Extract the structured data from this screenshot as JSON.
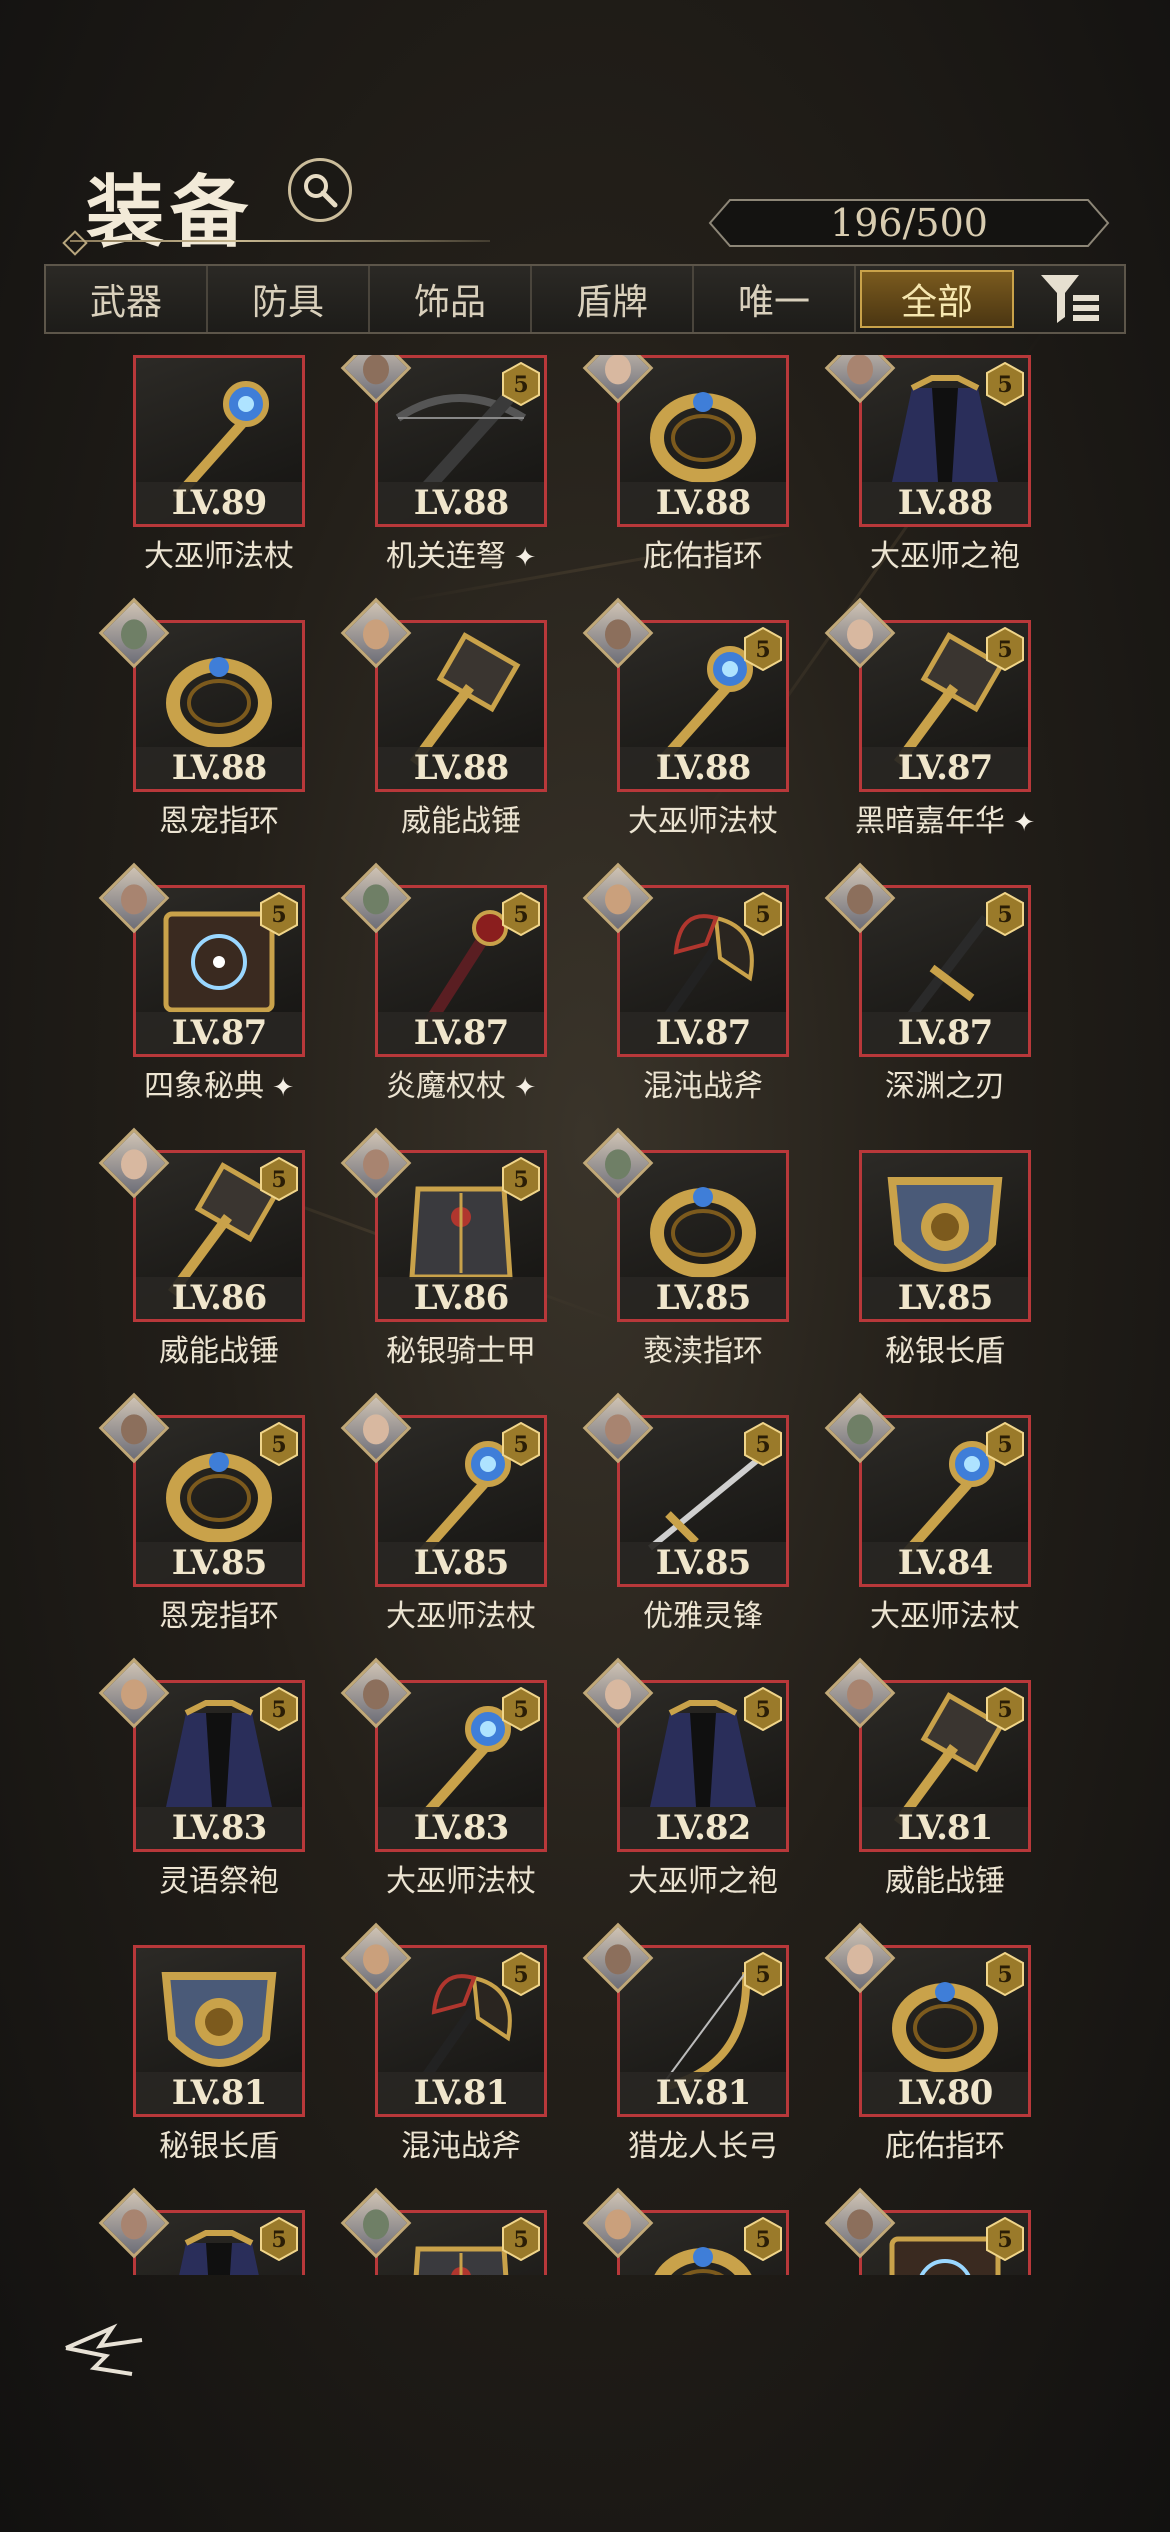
{
  "header": {
    "title": "装备",
    "count": "196/500"
  },
  "tabs": [
    {
      "label": "武器",
      "active": false
    },
    {
      "label": "防具",
      "active": false
    },
    {
      "label": "饰品",
      "active": false
    },
    {
      "label": "盾牌",
      "active": false
    },
    {
      "label": "唯一",
      "active": false
    },
    {
      "label": "全部",
      "active": true
    }
  ],
  "items": [
    {
      "lv": "LV.89",
      "name": "大巫师法杖",
      "star": "",
      "portrait": false,
      "special": false,
      "art": "staff"
    },
    {
      "lv": "LV.88",
      "name": "机关连弩",
      "star": "5",
      "portrait": true,
      "special": true,
      "art": "crossbow"
    },
    {
      "lv": "LV.88",
      "name": "庇佑指环",
      "star": "",
      "portrait": true,
      "special": false,
      "art": "ring"
    },
    {
      "lv": "LV.88",
      "name": "大巫师之袍",
      "star": "5",
      "portrait": true,
      "special": false,
      "art": "robe"
    },
    {
      "lv": "LV.88",
      "name": "恩宠指环",
      "star": "",
      "portrait": true,
      "special": false,
      "art": "ring"
    },
    {
      "lv": "LV.88",
      "name": "威能战锤",
      "star": "",
      "portrait": true,
      "special": false,
      "art": "hammer"
    },
    {
      "lv": "LV.88",
      "name": "大巫师法杖",
      "star": "5",
      "portrait": true,
      "special": false,
      "art": "staff"
    },
    {
      "lv": "LV.87",
      "name": "黑暗嘉年华",
      "star": "5",
      "portrait": true,
      "special": true,
      "art": "hammer"
    },
    {
      "lv": "LV.87",
      "name": "四象秘典",
      "star": "5",
      "portrait": true,
      "special": true,
      "art": "book"
    },
    {
      "lv": "LV.87",
      "name": "炎魔权杖",
      "star": "5",
      "portrait": true,
      "special": true,
      "art": "scepter"
    },
    {
      "lv": "LV.87",
      "name": "混沌战斧",
      "star": "5",
      "portrait": true,
      "special": false,
      "art": "axe"
    },
    {
      "lv": "LV.87",
      "name": "深渊之刃",
      "star": "5",
      "portrait": true,
      "special": false,
      "art": "blade"
    },
    {
      "lv": "LV.86",
      "name": "威能战锤",
      "star": "5",
      "portrait": true,
      "special": false,
      "art": "hammer"
    },
    {
      "lv": "LV.86",
      "name": "秘银骑士甲",
      "star": "5",
      "portrait": true,
      "special": false,
      "art": "armor"
    },
    {
      "lv": "LV.85",
      "name": "亵渎指环",
      "star": "",
      "portrait": true,
      "special": false,
      "art": "ring"
    },
    {
      "lv": "LV.85",
      "name": "秘银长盾",
      "star": "",
      "portrait": false,
      "special": false,
      "art": "shield"
    },
    {
      "lv": "LV.85",
      "name": "恩宠指环",
      "star": "5",
      "portrait": true,
      "special": false,
      "art": "ring"
    },
    {
      "lv": "LV.85",
      "name": "大巫师法杖",
      "star": "5",
      "portrait": true,
      "special": false,
      "art": "staff"
    },
    {
      "lv": "LV.85",
      "name": "优雅灵锋",
      "star": "5",
      "portrait": true,
      "special": false,
      "art": "sword"
    },
    {
      "lv": "LV.84",
      "name": "大巫师法杖",
      "star": "5",
      "portrait": true,
      "special": false,
      "art": "staff"
    },
    {
      "lv": "LV.83",
      "name": "灵语祭袍",
      "star": "5",
      "portrait": true,
      "special": false,
      "art": "robe"
    },
    {
      "lv": "LV.83",
      "name": "大巫师法杖",
      "star": "5",
      "portrait": true,
      "special": false,
      "art": "staff"
    },
    {
      "lv": "LV.82",
      "name": "大巫师之袍",
      "star": "5",
      "portrait": true,
      "special": false,
      "art": "robe"
    },
    {
      "lv": "LV.81",
      "name": "威能战锤",
      "star": "5",
      "portrait": true,
      "special": false,
      "art": "hammer"
    },
    {
      "lv": "LV.81",
      "name": "秘银长盾",
      "star": "",
      "portrait": false,
      "special": false,
      "art": "shield"
    },
    {
      "lv": "LV.81",
      "name": "混沌战斧",
      "star": "5",
      "portrait": true,
      "special": false,
      "art": "axe"
    },
    {
      "lv": "LV.81",
      "name": "猎龙人长弓",
      "star": "5",
      "portrait": true,
      "special": false,
      "art": "bow"
    },
    {
      "lv": "LV.80",
      "name": "庇佑指环",
      "star": "5",
      "portrait": true,
      "special": false,
      "art": "ring"
    },
    {
      "lv": "",
      "name": "",
      "star": "5",
      "portrait": true,
      "special": false,
      "art": "robe"
    },
    {
      "lv": "",
      "name": "",
      "star": "5",
      "portrait": true,
      "special": false,
      "art": "armor"
    },
    {
      "lv": "",
      "name": "",
      "star": "5",
      "portrait": true,
      "special": false,
      "art": "ring"
    },
    {
      "lv": "",
      "name": "",
      "star": "5",
      "portrait": true,
      "special": false,
      "art": "book"
    }
  ],
  "colors": {
    "accent": "#c9a24a",
    "card_border": "#b8383a",
    "star_badge": "#9a7a2a"
  },
  "icons": {
    "search": "search-icon",
    "filter": "filter-sort-icon",
    "back": "back-logo-icon",
    "special": "sparkle-icon"
  }
}
